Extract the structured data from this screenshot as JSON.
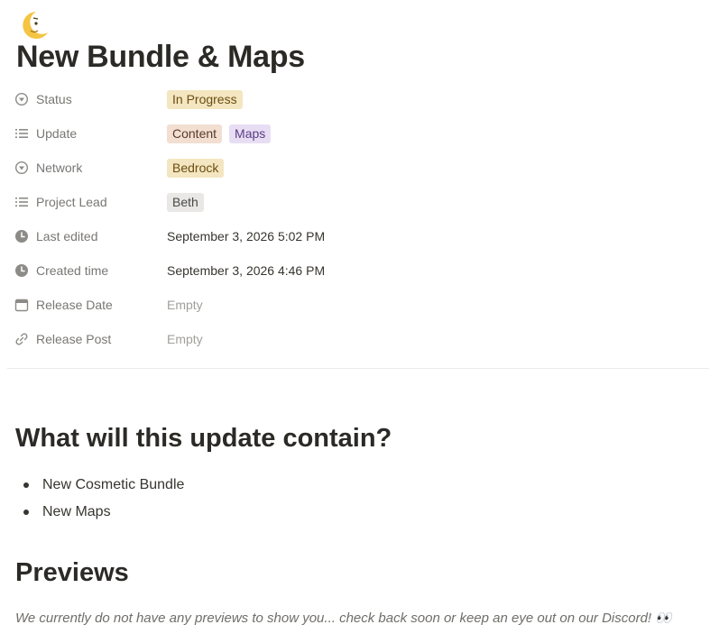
{
  "page": {
    "icon": "crescent-moon-face-icon",
    "title": "New Bundle & Maps"
  },
  "properties": [
    {
      "name": "Status",
      "icon": "status-icon",
      "type": "tags",
      "values": [
        {
          "label": "In Progress",
          "color": "#f3e6c0"
        }
      ]
    },
    {
      "name": "Update",
      "icon": "list-icon",
      "type": "tags",
      "values": [
        {
          "label": "Content",
          "color": "#f2dfd2"
        },
        {
          "label": "Maps",
          "color": "#e8def4"
        }
      ]
    },
    {
      "name": "Network",
      "icon": "status-icon",
      "type": "tags",
      "values": [
        {
          "label": "Bedrock",
          "color": "#f3e6c0"
        }
      ]
    },
    {
      "name": "Project Lead",
      "icon": "list-icon",
      "type": "tags",
      "values": [
        {
          "label": "Beth",
          "color": "#e9e8e6"
        }
      ]
    },
    {
      "name": "Last edited",
      "icon": "clock-icon",
      "type": "date",
      "value": "September 3, 2026 5:02 PM"
    },
    {
      "name": "Created time",
      "icon": "clock-icon",
      "type": "date",
      "value": "September 3, 2026 4:46 PM"
    },
    {
      "name": "Release Date",
      "icon": "calendar-icon",
      "type": "empty",
      "value": "Empty"
    },
    {
      "name": "Release Post",
      "icon": "link-icon",
      "type": "empty",
      "value": "Empty"
    }
  ],
  "content": {
    "heading1": "What will this update contain?",
    "bullets": [
      "New Cosmetic Bundle",
      "New Maps"
    ],
    "heading2": "Previews",
    "note": "We currently do not have any previews to show you... check back soon or keep an eye out on our Discord! 👀"
  }
}
